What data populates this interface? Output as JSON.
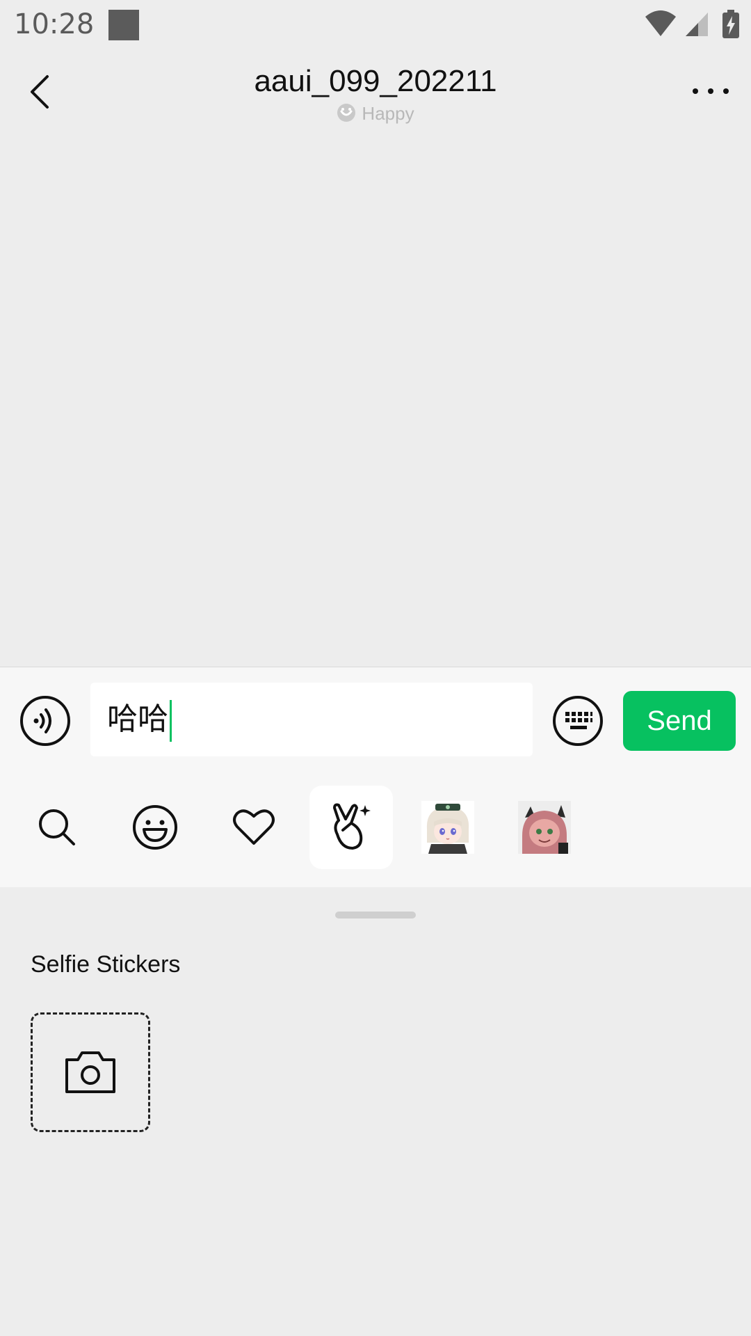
{
  "status_bar": {
    "time": "10:28"
  },
  "header": {
    "title": "aaui_099_202211",
    "subtitle": "Happy"
  },
  "input": {
    "value": "哈哈",
    "send_label": "Send"
  },
  "sticker_tabs": [
    {
      "icon": "search-icon",
      "active": false
    },
    {
      "icon": "emoji-icon",
      "active": false
    },
    {
      "icon": "heart-icon",
      "active": false
    },
    {
      "icon": "peace-hand-icon",
      "active": true
    },
    {
      "icon": "sticker-pack-anime-girl-1",
      "active": false
    },
    {
      "icon": "sticker-pack-anime-girl-2",
      "active": false
    }
  ],
  "sticker_panel": {
    "section_title": "Selfie Stickers"
  },
  "colors": {
    "accent": "#07C160",
    "background": "#EDEDED",
    "input_region": "#F7F7F7"
  }
}
